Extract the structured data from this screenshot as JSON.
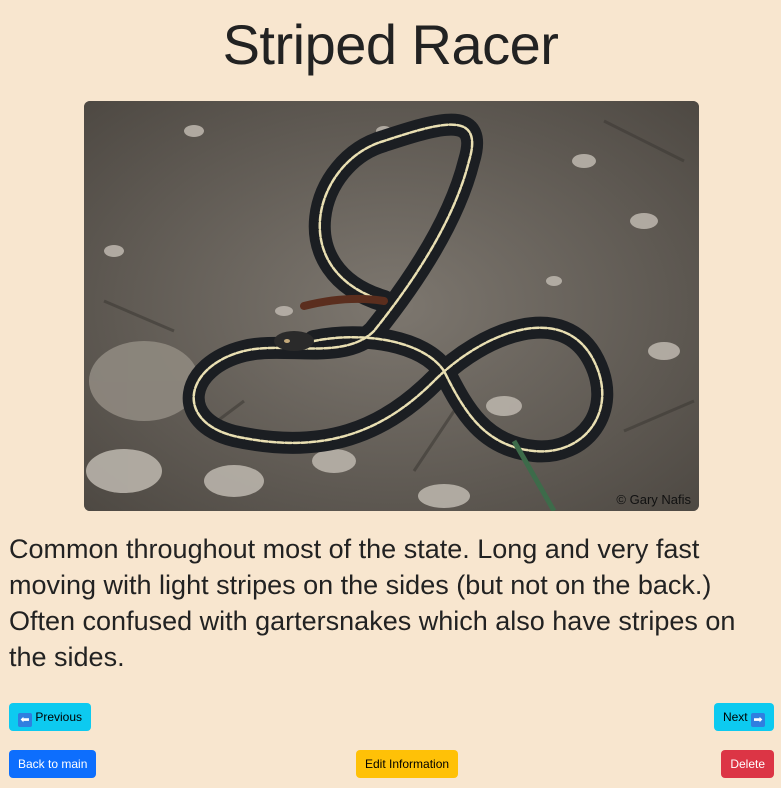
{
  "page": {
    "title": "Striped Racer",
    "photo_credit": "© Gary Nafis",
    "photo_alt": "striped-racer-snake-photo",
    "description": "Common throughout most of the state. Long and very fast moving with light stripes on the sides (but not on the back.) Often confused with gartersnakes which also have stripes on the sides."
  },
  "nav": {
    "previous_label": "Previous",
    "previous_icon": "⬅",
    "next_label": "Next",
    "next_icon": "➡"
  },
  "actions": {
    "back_label": "Back to main",
    "edit_label": "Edit Information",
    "delete_label": "Delete"
  },
  "colors": {
    "background": "#f8e6cf",
    "info": "#0dcaf0",
    "primary": "#0d6efd",
    "warning": "#ffc107",
    "danger": "#dc3545"
  }
}
